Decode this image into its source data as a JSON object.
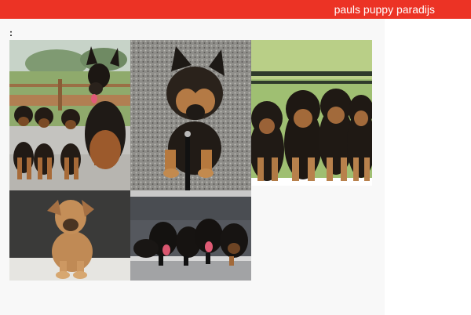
{
  "header": {
    "title": "pauls puppy paradijs",
    "bar_color": "#ec3325"
  },
  "main": {
    "label": ":",
    "gallery": [
      {
        "name": "photo-adult-dog-with-puppies",
        "icon": "dog-photo"
      },
      {
        "name": "photo-puppy-on-gravel",
        "icon": "dog-photo"
      },
      {
        "name": "photo-puppy-litter-sitting",
        "icon": "dog-photo"
      },
      {
        "name": "photo-light-puppy-sitting",
        "icon": "dog-photo"
      },
      {
        "name": "photo-black-puppies-on-couch",
        "icon": "dog-photo"
      }
    ]
  }
}
